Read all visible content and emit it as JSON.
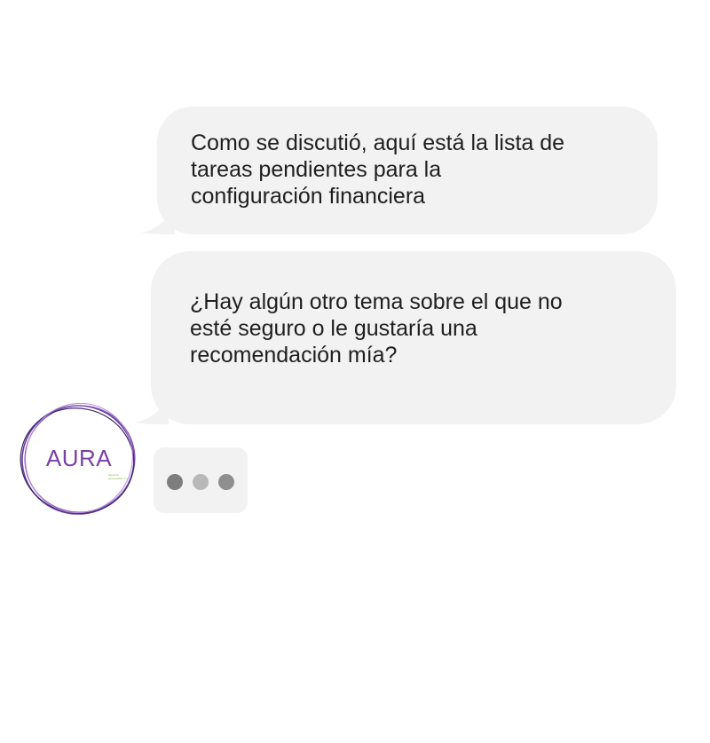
{
  "messages": [
    {
      "text": "Como se discutió, aquí está la lista de\ntareas pendientes para la\nconfiguración financiera"
    },
    {
      "text": "¿Hay algún otro tema sobre el que no\nesté seguro o le gustaría una\nrecomendación mía?"
    }
  ],
  "avatar": {
    "name": "AURA",
    "tagline": "asesoría\nempresarial, s.c.",
    "ring_color": "#6a3d9a",
    "accent_color": "#7fb23a"
  },
  "typing_indicator": {
    "dots": 3
  },
  "colors": {
    "bubble_background": "#f2f2f2",
    "text": "#1f1f1f",
    "brand": "#7b3fa6"
  }
}
